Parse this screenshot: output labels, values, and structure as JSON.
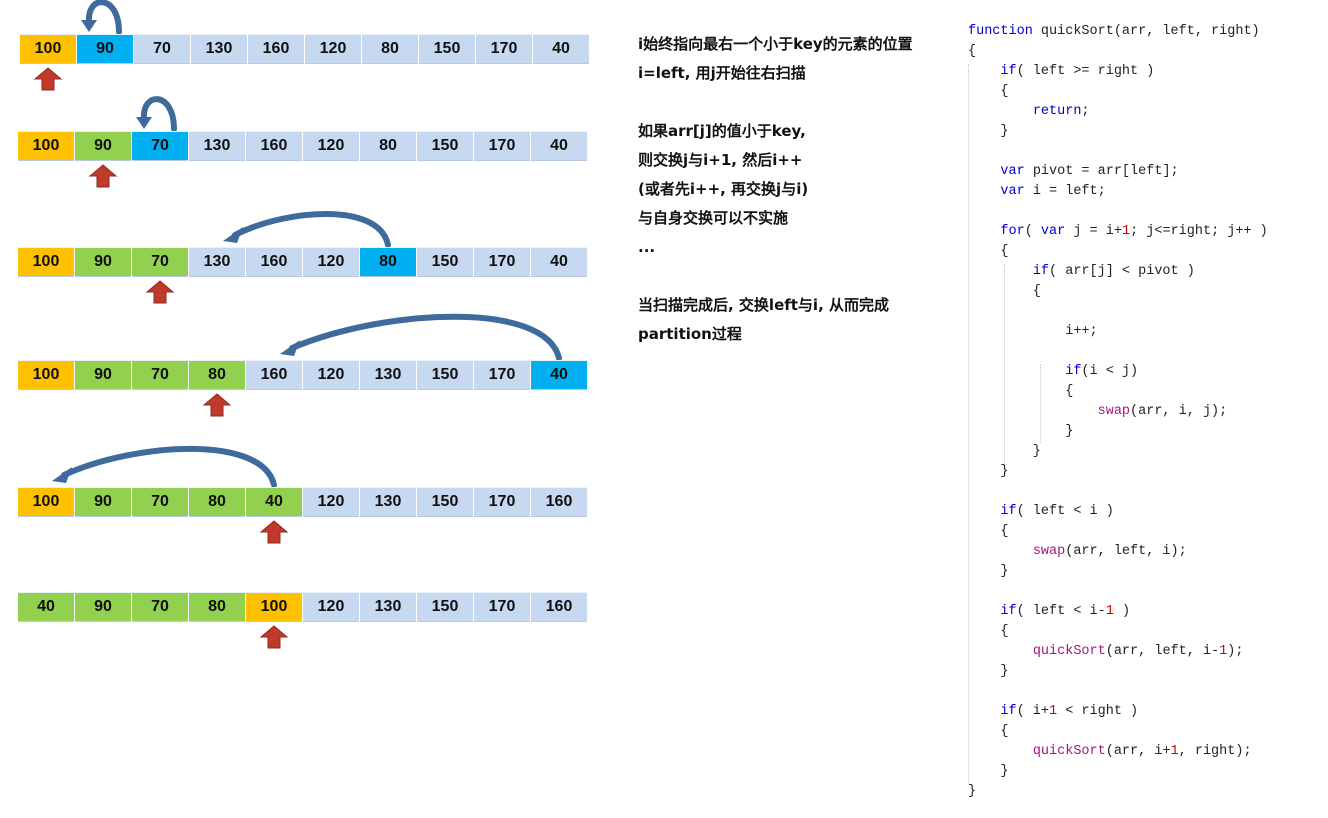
{
  "colors": {
    "pivot": "#ffc000",
    "less": "#92d050",
    "current": "#00b0f0",
    "rest": "#c6d9f0",
    "pointer_arrow": "#c0392b",
    "swap_arrow": "#3f6a9c"
  },
  "rows": [
    {
      "values": [
        "100",
        "90",
        "70",
        "130",
        "160",
        "120",
        "80",
        "150",
        "170",
        "40"
      ],
      "states": [
        "pivot",
        "cur",
        "rest",
        "rest",
        "rest",
        "rest",
        "rest",
        "rest",
        "rest",
        "rest"
      ],
      "pointer_index": 0,
      "swap_from": 1,
      "swap_to": 1
    },
    {
      "values": [
        "100",
        "90",
        "70",
        "130",
        "160",
        "120",
        "80",
        "150",
        "170",
        "40"
      ],
      "states": [
        "pivot",
        "less",
        "cur",
        "rest",
        "rest",
        "rest",
        "rest",
        "rest",
        "rest",
        "rest"
      ],
      "pointer_index": 1,
      "swap_from": 2,
      "swap_to": 2
    },
    {
      "values": [
        "100",
        "90",
        "70",
        "130",
        "160",
        "120",
        "80",
        "150",
        "170",
        "40"
      ],
      "states": [
        "pivot",
        "less",
        "less",
        "rest",
        "rest",
        "rest",
        "cur",
        "rest",
        "rest",
        "rest"
      ],
      "pointer_index": 2,
      "swap_from": 6,
      "swap_to": 3
    },
    {
      "values": [
        "100",
        "90",
        "70",
        "80",
        "160",
        "120",
        "130",
        "150",
        "170",
        "40"
      ],
      "states": [
        "pivot",
        "less",
        "less",
        "less",
        "rest",
        "rest",
        "rest",
        "rest",
        "rest",
        "cur"
      ],
      "pointer_index": 3,
      "swap_from": 9,
      "swap_to": 4
    },
    {
      "values": [
        "100",
        "90",
        "70",
        "80",
        "40",
        "120",
        "130",
        "150",
        "170",
        "160"
      ],
      "states": [
        "pivot",
        "less",
        "less",
        "less",
        "less",
        "rest",
        "rest",
        "rest",
        "rest",
        "rest"
      ],
      "pointer_index": 4,
      "swap_from": 4,
      "swap_to": 0
    },
    {
      "values": [
        "40",
        "90",
        "70",
        "80",
        "100",
        "120",
        "130",
        "150",
        "170",
        "160"
      ],
      "states": [
        "less",
        "less",
        "less",
        "less",
        "pivot",
        "rest",
        "rest",
        "rest",
        "rest",
        "rest"
      ],
      "pointer_index": 4,
      "swap_from": null,
      "swap_to": null
    }
  ],
  "explanation": [
    "i始终指向最右一个小于key的元素的位置",
    "i=left, 用j开始往右扫描",
    "",
    "如果arr[j]的值小于key,",
    "则交换j与i+1, 然后i++",
    "(或者先i++, 再交换j与i)",
    "与自身交换可以不实施",
    "...",
    "",
    "当扫描完成后, 交换left与i, 从而完成",
    "partition过程"
  ],
  "code": [
    "function quickSort(arr, left, right)",
    "{",
    "    if( left >= right )",
    "    {",
    "        return;",
    "    }",
    "",
    "    var pivot = arr[left];",
    "    var i = left;",
    "",
    "    for( var j = i+1; j<=right; j++ )",
    "    {",
    "        if( arr[j] < pivot )",
    "        {",
    "",
    "            i++;",
    "",
    "            if(i < j)",
    "            {",
    "                swap(arr, i, j);",
    "            }",
    "        }",
    "    }",
    "",
    "    if( left < i )",
    "    {",
    "        swap(arr, left, i);",
    "    }",
    "",
    "    if( left < i-1 )",
    "    {",
    "        quickSort(arr, left, i-1);",
    "    }",
    "",
    "    if( i+1 < right )",
    "    {",
    "        quickSort(arr, i+1, right);",
    "    }",
    "}"
  ]
}
